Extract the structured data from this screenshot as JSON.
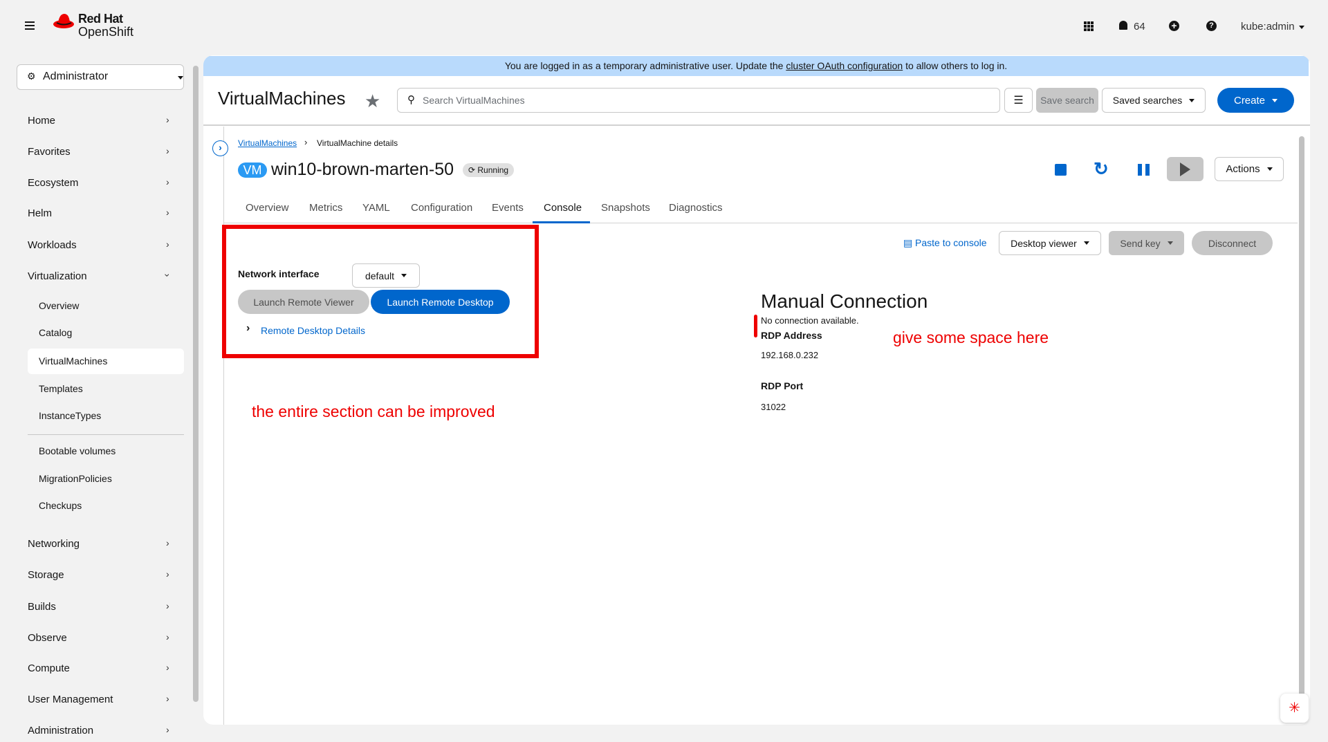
{
  "masthead": {
    "brand_line1": "Red Hat",
    "brand_line2": "OpenShift",
    "notifications_count": "64",
    "user": "kube:admin"
  },
  "sidebar": {
    "perspective": "Administrator",
    "items": [
      {
        "label": "Home"
      },
      {
        "label": "Favorites"
      },
      {
        "label": "Ecosystem"
      },
      {
        "label": "Helm"
      },
      {
        "label": "Workloads"
      },
      {
        "label": "Virtualization"
      }
    ],
    "virtualization_sub": [
      {
        "label": "Overview"
      },
      {
        "label": "Catalog"
      },
      {
        "label": "VirtualMachines"
      },
      {
        "label": "Templates"
      },
      {
        "label": "InstanceTypes"
      },
      {
        "label": "Bootable volumes"
      },
      {
        "label": "MigrationPolicies"
      },
      {
        "label": "Checkups"
      }
    ],
    "items_after": [
      {
        "label": "Networking"
      },
      {
        "label": "Storage"
      },
      {
        "label": "Builds"
      },
      {
        "label": "Observe"
      },
      {
        "label": "Compute"
      },
      {
        "label": "User Management"
      },
      {
        "label": "Administration"
      }
    ]
  },
  "banner": {
    "text_before": "You are logged in as a temporary administrative user. Update the ",
    "link": "cluster OAuth configuration",
    "text_after": " to allow others to log in."
  },
  "header": {
    "title": "VirtualMachines",
    "search_placeholder": "Search VirtualMachines",
    "save_search": "Save search",
    "saved_searches": "Saved searches",
    "create": "Create"
  },
  "breadcrumb": {
    "parent": "VirtualMachines",
    "current": "VirtualMachine details"
  },
  "vm": {
    "badge": "VM",
    "name": "win10-brown-marten-50",
    "status": "Running",
    "actions": "Actions"
  },
  "tabs": [
    "Overview",
    "Metrics",
    "YAML",
    "Configuration",
    "Events",
    "Console",
    "Snapshots",
    "Diagnostics"
  ],
  "active_tab": "Console",
  "console": {
    "network_label": "Network interface",
    "network_value": "default",
    "launch_viewer": "Launch Remote Viewer",
    "launch_desktop": "Launch Remote Desktop",
    "details": "Remote Desktop Details",
    "paste": "Paste to console",
    "viewer": "Desktop viewer",
    "send_key": "Send key",
    "disconnect": "Disconnect",
    "manual_title": "Manual Connection",
    "no_connection": "No connection available.",
    "rdp_address_label": "RDP Address",
    "rdp_address": "192.168.0.232",
    "rdp_port_label": "RDP Port",
    "rdp_port": "31022"
  },
  "annotations": {
    "section": "the entire section can be improved",
    "space": "give some space here"
  },
  "colors": {
    "primary": "#0066cc",
    "annotation": "#ee0000",
    "banner": "#b9dafc"
  }
}
